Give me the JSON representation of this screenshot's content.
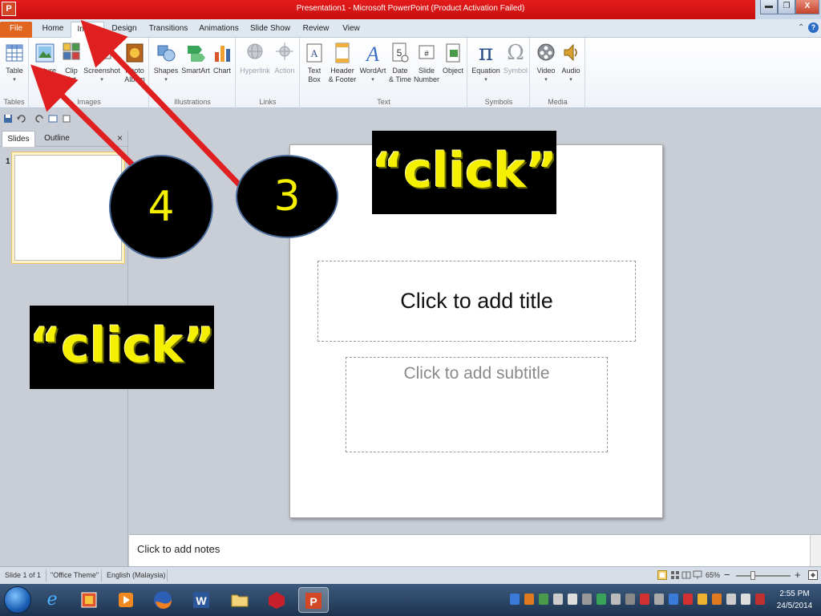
{
  "window": {
    "title": "Presentation1  -  Microsoft PowerPoint (Product Activation Failed)",
    "app_icon": "P",
    "min_label": "▬",
    "max_label": "❐",
    "close_label": "X"
  },
  "tabs": [
    "File",
    "Home",
    "Insert",
    "Design",
    "Transitions",
    "Animations",
    "Slide Show",
    "Review",
    "View"
  ],
  "active_tab": "Insert",
  "ribbon": {
    "groups": {
      "tables": "Tables",
      "images": "Images",
      "illustrations": "Illustrations",
      "links": "Links",
      "text": "Text",
      "symbols": "Symbols",
      "media": "Media"
    },
    "buttons": {
      "table": [
        "Table",
        ""
      ],
      "picture": [
        "Picture",
        ""
      ],
      "clip_art": [
        "Clip",
        "Art"
      ],
      "screenshot": [
        "Screenshot",
        ""
      ],
      "photo_album": [
        "Photo",
        "Album"
      ],
      "shapes": [
        "Shapes",
        ""
      ],
      "smartart": [
        "SmartArt",
        ""
      ],
      "chart": [
        "Chart",
        ""
      ],
      "hyperlink": [
        "Hyperlink",
        ""
      ],
      "action": [
        "Action",
        ""
      ],
      "text_box": [
        "Text",
        "Box"
      ],
      "header_footer": [
        "Header",
        "& Footer"
      ],
      "wordart": [
        "WordArt",
        ""
      ],
      "date_time": [
        "Date",
        "& Time"
      ],
      "slide_number": [
        "Slide",
        "Number"
      ],
      "object": [
        "Object",
        ""
      ],
      "equation": [
        "Equation",
        ""
      ],
      "symbol": [
        "Symbol",
        ""
      ],
      "video": [
        "Video",
        ""
      ],
      "audio": [
        "Audio",
        ""
      ]
    },
    "glyphs": {
      "equation": "π",
      "symbol": "Ω",
      "wordart": "A",
      "text_box": "A",
      "date_time": "5",
      "slide_number": "#"
    }
  },
  "pane": {
    "tabs": [
      "Slides",
      "Outline"
    ],
    "close": "×",
    "slide_index": "1"
  },
  "slide": {
    "title_placeholder": "Click to add title",
    "subtitle_placeholder": "Click to add subtitle"
  },
  "notes": {
    "placeholder": "Click to add notes"
  },
  "status": {
    "slide": "Slide 1 of 1",
    "theme": "\"Office Theme\"",
    "language": "English (Malaysia)",
    "zoom": "65%",
    "zoom_minus": "−",
    "zoom_plus": "+"
  },
  "taskbar": {
    "time": "2:55 PM",
    "date": "24/5/2014"
  },
  "annotations": {
    "callout_1": "“click”",
    "callout_2": "“click”",
    "step_3": "3",
    "step_4": "4"
  },
  "colors": {
    "title_bar": "#d41616",
    "file_tab": "#e1651f",
    "callout_text": "#f5f000",
    "arrow": "#e02020"
  }
}
